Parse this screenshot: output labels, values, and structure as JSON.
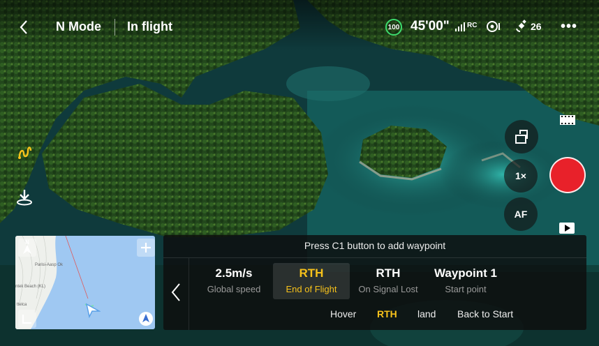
{
  "topbar": {
    "mode": "N Mode",
    "status": "In flight",
    "battery": "100",
    "flight_time": "45'00\"",
    "rc_label": "RC",
    "satellites": "26"
  },
  "hint": "Press C1 button to add waypoint",
  "settings": [
    {
      "value": "2.5m/s",
      "label": "Global speed",
      "selected": false
    },
    {
      "value": "RTH",
      "label": "End of Flight",
      "selected": true
    },
    {
      "value": "RTH",
      "label": "On Signal Lost",
      "selected": false
    },
    {
      "value": "Waypoint 1",
      "label": "Start point",
      "selected": false
    }
  ],
  "end_of_flight_options": [
    "Hover",
    "RTH",
    "land",
    "Back to Start"
  ],
  "end_of_flight_selected": "RTH",
  "camera": {
    "zoom": "1×",
    "focus": "AF"
  },
  "minimap": {
    "north_label": "N",
    "pois": [
      "Parisi-Aasp Ok",
      "ntek Beach (KL)",
      "ttelca"
    ]
  },
  "colors": {
    "accent": "#f7c21b",
    "record": "#e8212a",
    "battery_ring": "#3ddc6e"
  }
}
